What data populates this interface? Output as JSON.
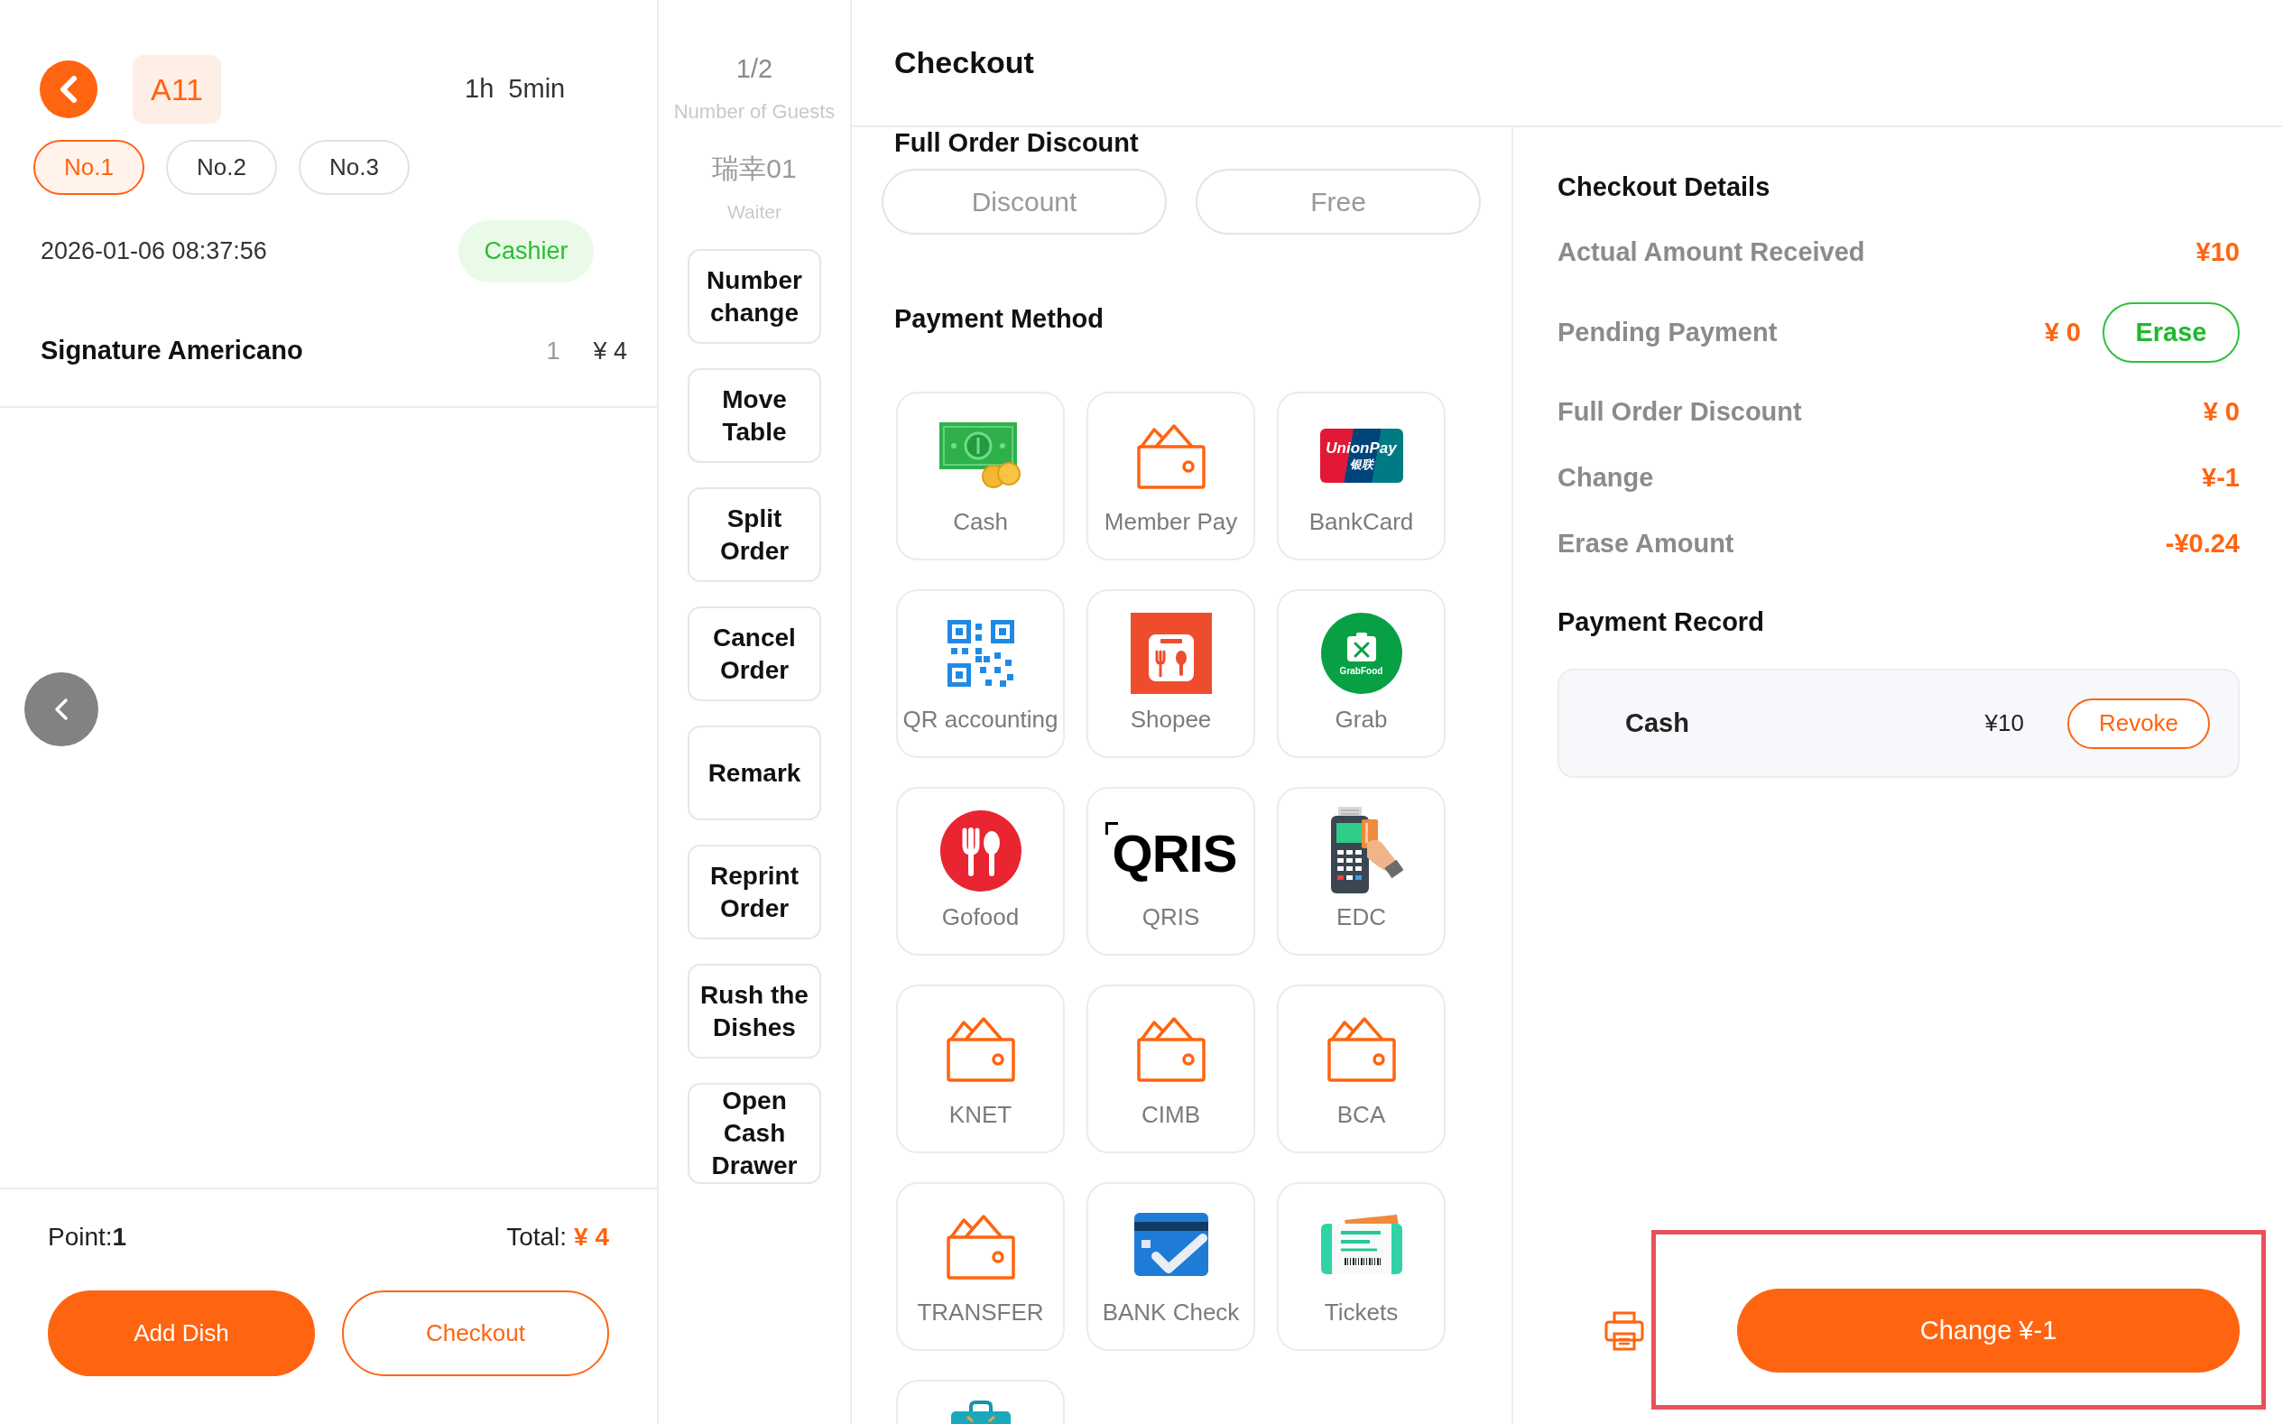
{
  "order_panel": {
    "table": "A11",
    "duration": "1h  5min",
    "seats": [
      {
        "label": "No.1",
        "selected": true
      },
      {
        "label": "No.2",
        "selected": false
      },
      {
        "label": "No.3",
        "selected": false
      }
    ],
    "time": "2026-01-06 08:37:56",
    "role_badge": "Cashier",
    "items": [
      {
        "name": "Signature Americano",
        "quantity": "1",
        "price": "¥ 4"
      }
    ],
    "points": "Point:**1**",
    "total_label": "Total:",
    "total": "¥ 4",
    "buttons": [
      {
        "label": "Add Dish",
        "kind": "primary"
      },
      {
        "label": "Checkout",
        "kind": "outline"
      }
    ]
  },
  "info_column": {
    "guests": "1/2",
    "guests_label": "Number of Guests",
    "waiter": "瑞幸01",
    "waiter_label": "Waiter",
    "actions": [
      "Number change",
      "Move Table",
      "Split Order",
      "Cancel Order",
      "Remark",
      "Reprint Order",
      "Rush the Dishes",
      "Open Cash Drawer"
    ]
  },
  "checkout": {
    "title": "Checkout",
    "discount_heading": "Full Order Discount",
    "discount_options": [
      "Discount",
      "Free"
    ],
    "payment_heading": "Payment Method",
    "payment_methods": [
      {
        "label": "Cash",
        "kind": "cash"
      },
      {
        "label": "Member Pay",
        "kind": "wallet"
      },
      {
        "label": "BankCard",
        "kind": "card",
        "logo_text": [
          "UnionPay",
          "银联"
        ]
      },
      {
        "label": "QR accounting",
        "kind": "qr"
      },
      {
        "label": "Shopee",
        "kind": "shop"
      },
      {
        "label": "Grab",
        "kind": "delivery",
        "logo_text": [
          "GrabFood"
        ]
      },
      {
        "label": "Gofood",
        "kind": "food"
      },
      {
        "label": "QRIS",
        "kind": "qris",
        "logo_text": [
          "QRIS"
        ]
      },
      {
        "label": "EDC",
        "kind": "terminal"
      },
      {
        "label": "KNET",
        "kind": "wallet"
      },
      {
        "label": "CIMB",
        "kind": "wallet"
      },
      {
        "label": "BCA",
        "kind": "wallet"
      },
      {
        "label": "TRANSFER",
        "kind": "wallet"
      },
      {
        "label": "BANK Check",
        "kind": "check"
      },
      {
        "label": "Tickets",
        "kind": "ticket"
      },
      {
        "kind": "toolbox"
      }
    ]
  },
  "details": {
    "heading": "Checkout Details",
    "rows": [
      {
        "label": "Actual Amount Received",
        "value": "¥10"
      },
      {
        "label": "Pending Payment",
        "value": "¥ 0",
        "action": "Erase"
      },
      {
        "label": "Full Order Discount",
        "value": "¥ 0"
      },
      {
        "label": "Change",
        "value": "¥-1"
      },
      {
        "label": "Erase Amount",
        "value": "-¥0.24"
      }
    ],
    "record_heading": "Payment Record",
    "records": [
      {
        "method": "Cash",
        "amount": "¥10",
        "action": "Revoke"
      }
    ],
    "confirm_button": "Change ¥-1"
  }
}
